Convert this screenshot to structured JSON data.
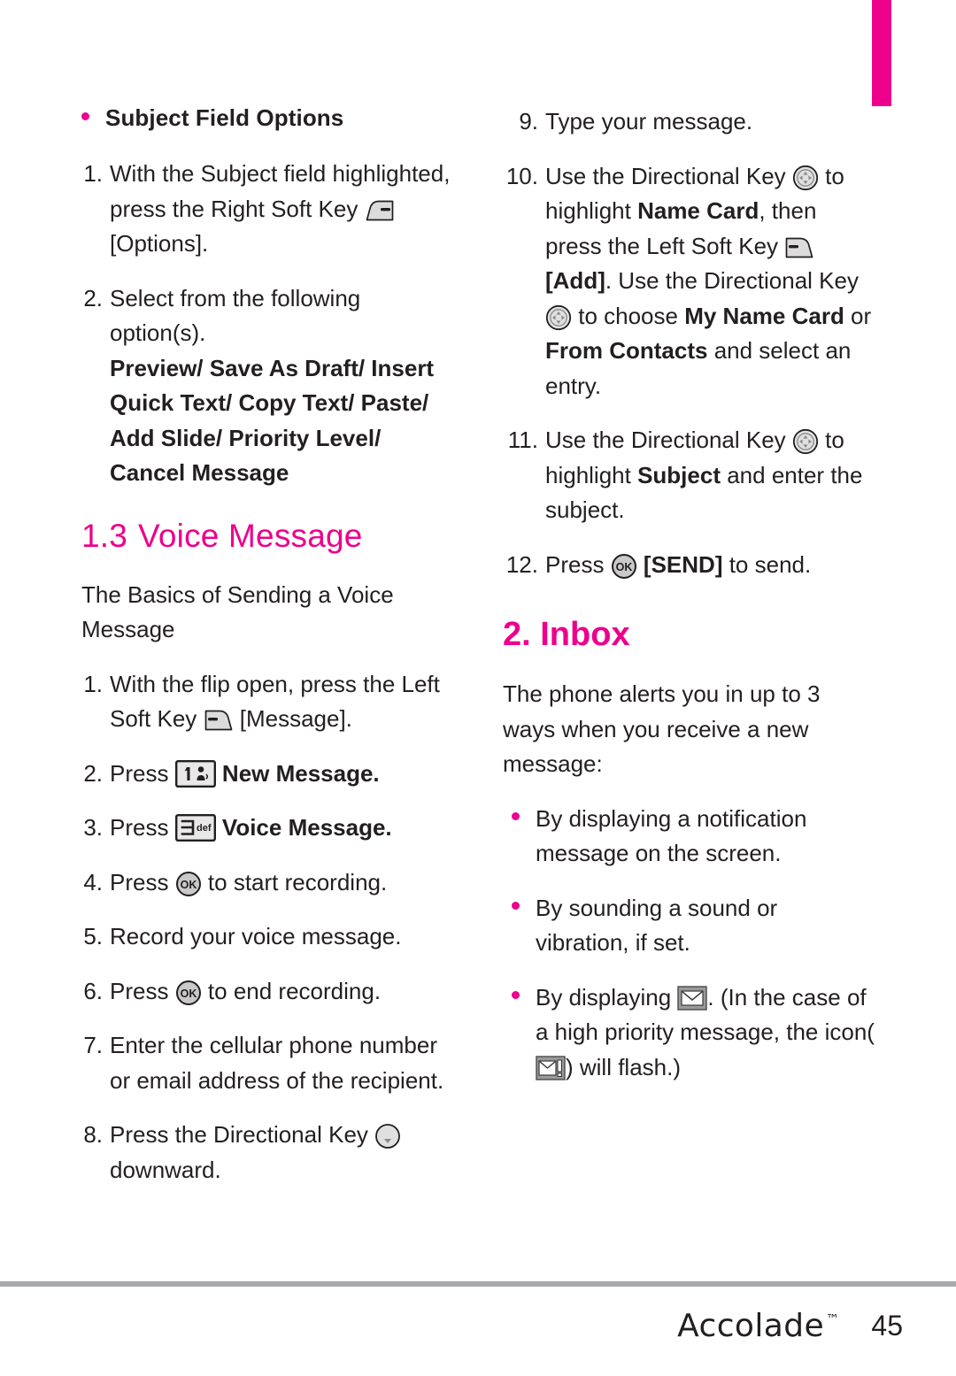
{
  "footer": {
    "brand": "Accolade",
    "trademark": "™",
    "page_number": "45",
    "accent_color": "#ec008c",
    "rule_color": "#a7a9ac"
  },
  "left_column": {
    "bullet_heading": "Subject Field Options",
    "steps": [
      {
        "number": "1.",
        "text_a": "With the Subject field highlighted, press the Right Soft Key ",
        "icon": "right-soft-key-icon",
        "text_b": " [Options]."
      },
      {
        "number": "2.",
        "text_a": "Select from the following option(s).",
        "options": "Preview/ Save As Draft/ Insert Quick Text/ Copy Text/ Paste/ Add Slide/ Priority Level/ Cancel Message"
      }
    ],
    "section_heading": {
      "number": "1.3",
      "title": "Voice Message"
    },
    "intro": "The Basics of Sending a Voice Message",
    "voice_steps": [
      {
        "number": "1.",
        "text_a": "With the flip open, press the Left Soft Key ",
        "icon": "left-soft-key-icon",
        "text_b": " [Message]."
      },
      {
        "number": "2.",
        "text_a": "Press ",
        "icon": "key-1-voicemail-icon",
        "text_b": " New Message.",
        "bold_tail": true
      },
      {
        "number": "3.",
        "text_a": "Press ",
        "icon": "key-3-def-icon",
        "text_b": " Voice Message.",
        "bold_tail": true
      },
      {
        "number": "4.",
        "text_a": "Press ",
        "icon": "ok-key-icon",
        "text_b": " to start recording."
      },
      {
        "number": "5.",
        "text_a": "Record your voice message."
      },
      {
        "number": "6.",
        "text_a": "Press ",
        "icon": "ok-key-icon",
        "text_b": " to end recording."
      },
      {
        "number": "7.",
        "text_a": "Enter the cellular phone number or email address of the recipient."
      },
      {
        "number": "8.",
        "text_a": "Press the Directional Key ",
        "icon": "directional-key-down-icon",
        "text_b": " downward."
      }
    ]
  },
  "right_column": {
    "steps": [
      {
        "number": "9.",
        "text_a": "Type your message."
      },
      {
        "number": "10.",
        "seg1": "Use the Directional Key ",
        "icon1": "directional-key-4way-icon",
        "seg2": " to highlight ",
        "bold1": "Name Card",
        "seg3": ", then press the Left Soft  Key ",
        "icon2": "left-soft-key-icon",
        "seg4": " ",
        "bold2": "[Add]",
        "seg5": ". Use the Directional Key ",
        "icon3": "directional-key-4way-icon",
        "seg6": " to choose ",
        "bold3": "My Name Card",
        "seg7": " or ",
        "bold4": "From Contacts",
        "seg8": " and select an entry."
      },
      {
        "number": "11.",
        "seg1": "Use the Directional Key ",
        "icon1": "directional-key-4way-icon",
        "seg2": " to highlight ",
        "bold1": "Subject",
        "seg3": " and enter the subject."
      },
      {
        "number": "12.",
        "seg1": "Press ",
        "icon1": "ok-key-icon",
        "seg2": " ",
        "bold1": "[SEND]",
        "seg3": " to send."
      }
    ],
    "major_heading": "2. Inbox",
    "intro": "The phone alerts you in up to 3 ways when you receive a new message:",
    "alerts": [
      {
        "text": "By displaying a notification message  on the screen."
      },
      {
        "text": "By sounding a sound or vibration, if set."
      },
      {
        "seg1": "By displaying ",
        "icon1": "envelope-icon",
        "seg2": ". (In the case of a high priority message, the icon(",
        "icon2": "envelope-priority-icon",
        "seg3": ") will flash.)"
      }
    ]
  }
}
